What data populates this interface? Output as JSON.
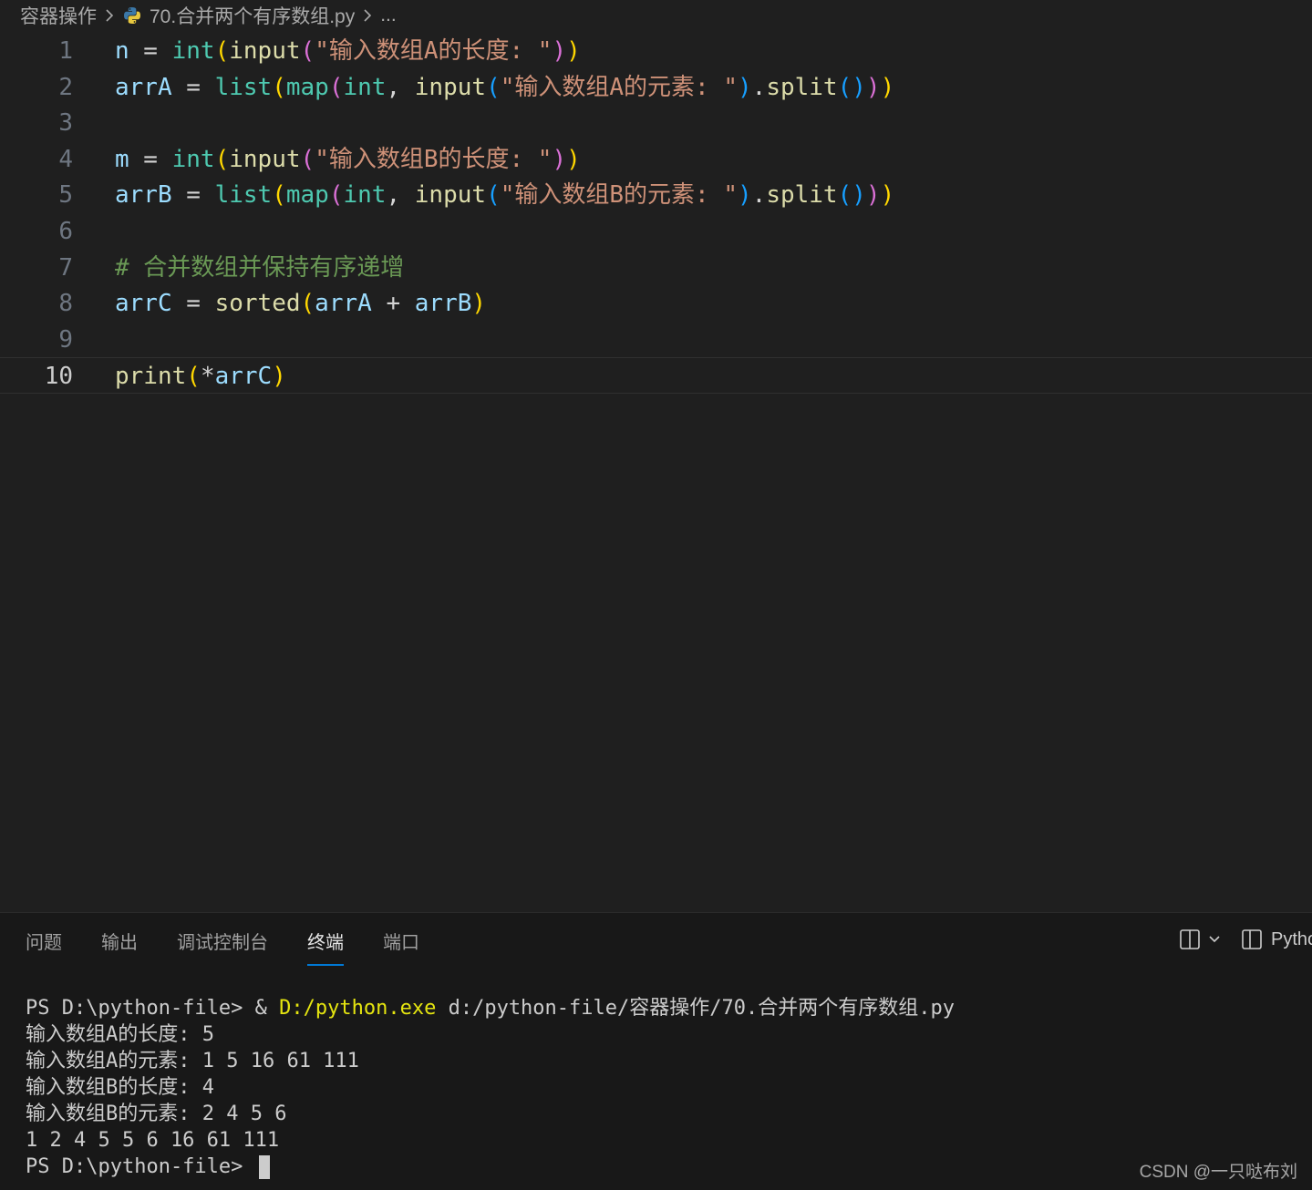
{
  "breadcrumb": {
    "folder": "容器操作",
    "file": "70.合并两个有序数组.py",
    "more": "..."
  },
  "editor": {
    "lines": [
      {
        "n": "1",
        "tokens": [
          [
            "v",
            "n"
          ],
          [
            "p",
            " = "
          ],
          [
            "c",
            "int"
          ],
          [
            "b1",
            "("
          ],
          [
            "f",
            "input"
          ],
          [
            "b2",
            "("
          ],
          [
            "s",
            "\"输入数组A的长度: \""
          ],
          [
            "b2",
            ")"
          ],
          [
            "b1",
            ")"
          ]
        ]
      },
      {
        "n": "2",
        "tokens": [
          [
            "v",
            "arrA"
          ],
          [
            "p",
            " = "
          ],
          [
            "c",
            "list"
          ],
          [
            "b1",
            "("
          ],
          [
            "c",
            "map"
          ],
          [
            "b2",
            "("
          ],
          [
            "c",
            "int"
          ],
          [
            "p",
            ", "
          ],
          [
            "f",
            "input"
          ],
          [
            "b3",
            "("
          ],
          [
            "s",
            "\"输入数组A的元素: \""
          ],
          [
            "b3",
            ")"
          ],
          [
            "p",
            "."
          ],
          [
            "f",
            "split"
          ],
          [
            "b3",
            "()"
          ],
          [
            "b2",
            ")"
          ],
          [
            "b1",
            ")"
          ]
        ]
      },
      {
        "n": "3",
        "tokens": []
      },
      {
        "n": "4",
        "tokens": [
          [
            "v",
            "m"
          ],
          [
            "p",
            " = "
          ],
          [
            "c",
            "int"
          ],
          [
            "b1",
            "("
          ],
          [
            "f",
            "input"
          ],
          [
            "b2",
            "("
          ],
          [
            "s",
            "\"输入数组B的长度: \""
          ],
          [
            "b2",
            ")"
          ],
          [
            "b1",
            ")"
          ]
        ]
      },
      {
        "n": "5",
        "tokens": [
          [
            "v",
            "arrB"
          ],
          [
            "p",
            " = "
          ],
          [
            "c",
            "list"
          ],
          [
            "b1",
            "("
          ],
          [
            "c",
            "map"
          ],
          [
            "b2",
            "("
          ],
          [
            "c",
            "int"
          ],
          [
            "p",
            ", "
          ],
          [
            "f",
            "input"
          ],
          [
            "b3",
            "("
          ],
          [
            "s",
            "\"输入数组B的元素: \""
          ],
          [
            "b3",
            ")"
          ],
          [
            "p",
            "."
          ],
          [
            "f",
            "split"
          ],
          [
            "b3",
            "()"
          ],
          [
            "b2",
            ")"
          ],
          [
            "b1",
            ")"
          ]
        ]
      },
      {
        "n": "6",
        "tokens": []
      },
      {
        "n": "7",
        "tokens": [
          [
            "cm",
            "# 合并数组并保持有序递增"
          ]
        ]
      },
      {
        "n": "8",
        "tokens": [
          [
            "v",
            "arrC"
          ],
          [
            "p",
            " = "
          ],
          [
            "f",
            "sorted"
          ],
          [
            "b1",
            "("
          ],
          [
            "v",
            "arrA"
          ],
          [
            "p",
            " + "
          ],
          [
            "v",
            "arrB"
          ],
          [
            "b1",
            ")"
          ]
        ]
      },
      {
        "n": "9",
        "tokens": []
      },
      {
        "n": "10",
        "tokens": [
          [
            "f",
            "print"
          ],
          [
            "b1",
            "("
          ],
          [
            "p",
            "*"
          ],
          [
            "v",
            "arrC"
          ],
          [
            "b1",
            ")"
          ]
        ],
        "active": true
      }
    ]
  },
  "panel": {
    "tabs": [
      {
        "label": "问题",
        "active": false
      },
      {
        "label": "输出",
        "active": false
      },
      {
        "label": "调试控制台",
        "active": false
      },
      {
        "label": "终端",
        "active": true
      },
      {
        "label": "端口",
        "active": false
      }
    ],
    "terminal_label": "Pytho",
    "icons": [
      "split-panel-icon",
      "chevron-down-icon",
      "terminal-panel-icon"
    ]
  },
  "terminal": {
    "cmd_prefix": "PS D:\\python-file> & ",
    "cmd_exe": "D:/python.exe",
    "cmd_arg": " d:/python-file/容器操作/70.合并两个有序数组.py",
    "output": [
      "输入数组A的长度: 5",
      "输入数组A的元素: 1 5 16 61 111",
      "输入数组B的长度: 4",
      "输入数组B的元素: 2 4 5 6",
      "1 2 4 5 5 6 16 61 111"
    ],
    "prompt": "PS D:\\python-file> "
  },
  "watermark": "CSDN @一只哒布刘"
}
